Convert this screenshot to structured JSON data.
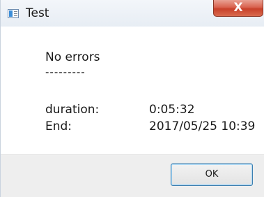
{
  "window": {
    "title": "Test",
    "close_glyph": "X",
    "app_icon": "app-window-icon"
  },
  "content": {
    "status": "No errors",
    "separator": "---------",
    "duration_label": "duration:",
    "duration_value": "0:05:32",
    "end_label": "End:",
    "end_value": "2017/05/25 10:39"
  },
  "footer": {
    "ok_label": "OK"
  },
  "colors": {
    "close_button": "#d9634f",
    "footer_background": "#eeeeee",
    "ok_border": "#3c7fb1"
  }
}
